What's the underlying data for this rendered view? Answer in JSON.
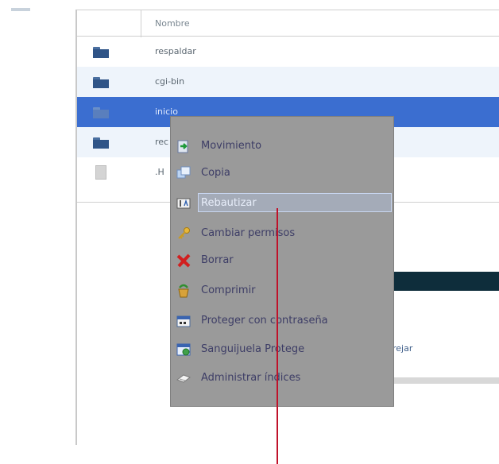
{
  "table": {
    "column_header": "Nombre",
    "rows": [
      {
        "name": "respaldar",
        "type": "folder"
      },
      {
        "name": "cgi-bin",
        "type": "folder"
      },
      {
        "name": "inicio",
        "type": "folder"
      },
      {
        "name": "rec",
        "type": "folder"
      },
      {
        "name": ".H",
        "type": "file"
      }
    ]
  },
  "context_menu": {
    "items": [
      {
        "label": "Movimiento",
        "icon": "move-icon"
      },
      {
        "label": "Copia",
        "icon": "copy-icon"
      },
      {
        "label": "Rebautizar",
        "icon": "rename-icon"
      },
      {
        "label": "Cambiar permisos",
        "icon": "key-icon"
      },
      {
        "label": "Borrar",
        "icon": "delete-icon"
      },
      {
        "label": "Comprimir",
        "icon": "compress-icon"
      },
      {
        "label": "Proteger con contraseña",
        "icon": "password-protect-icon"
      },
      {
        "label": "Sanguijuela Protege",
        "icon": "leech-protect-icon"
      },
      {
        "label": "Administrar índices",
        "icon": "index-manager-icon"
      }
    ]
  },
  "right_panel": {
    "link_text": "rejar"
  },
  "colors": {
    "selection": "#3b6ed0",
    "menu_bg": "#9a9a9a",
    "pointer": "#c0122a"
  }
}
